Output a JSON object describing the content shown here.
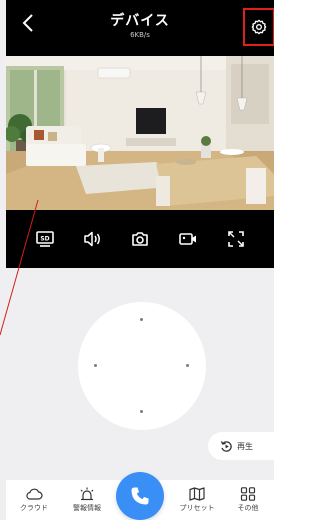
{
  "header": {
    "title": "デバイス",
    "speed": "6KB/s",
    "back_icon": "chevron-left-icon",
    "settings_icon": "gear-icon",
    "highlight_color": "#e0201a"
  },
  "toolbar": {
    "items": [
      {
        "icon": "sd-quality-icon",
        "label": "SD"
      },
      {
        "icon": "speaker-icon"
      },
      {
        "icon": "camera-snapshot-icon"
      },
      {
        "icon": "video-record-icon"
      },
      {
        "icon": "fullscreen-icon"
      }
    ]
  },
  "replay": {
    "label": "再生",
    "icon": "replay-icon"
  },
  "bottom_nav": {
    "cloud": "クラウド",
    "alarm": "警報情報",
    "preset": "プリセット",
    "other": "その他",
    "call_icon": "phone-icon",
    "call_color": "#3a8ff7"
  }
}
